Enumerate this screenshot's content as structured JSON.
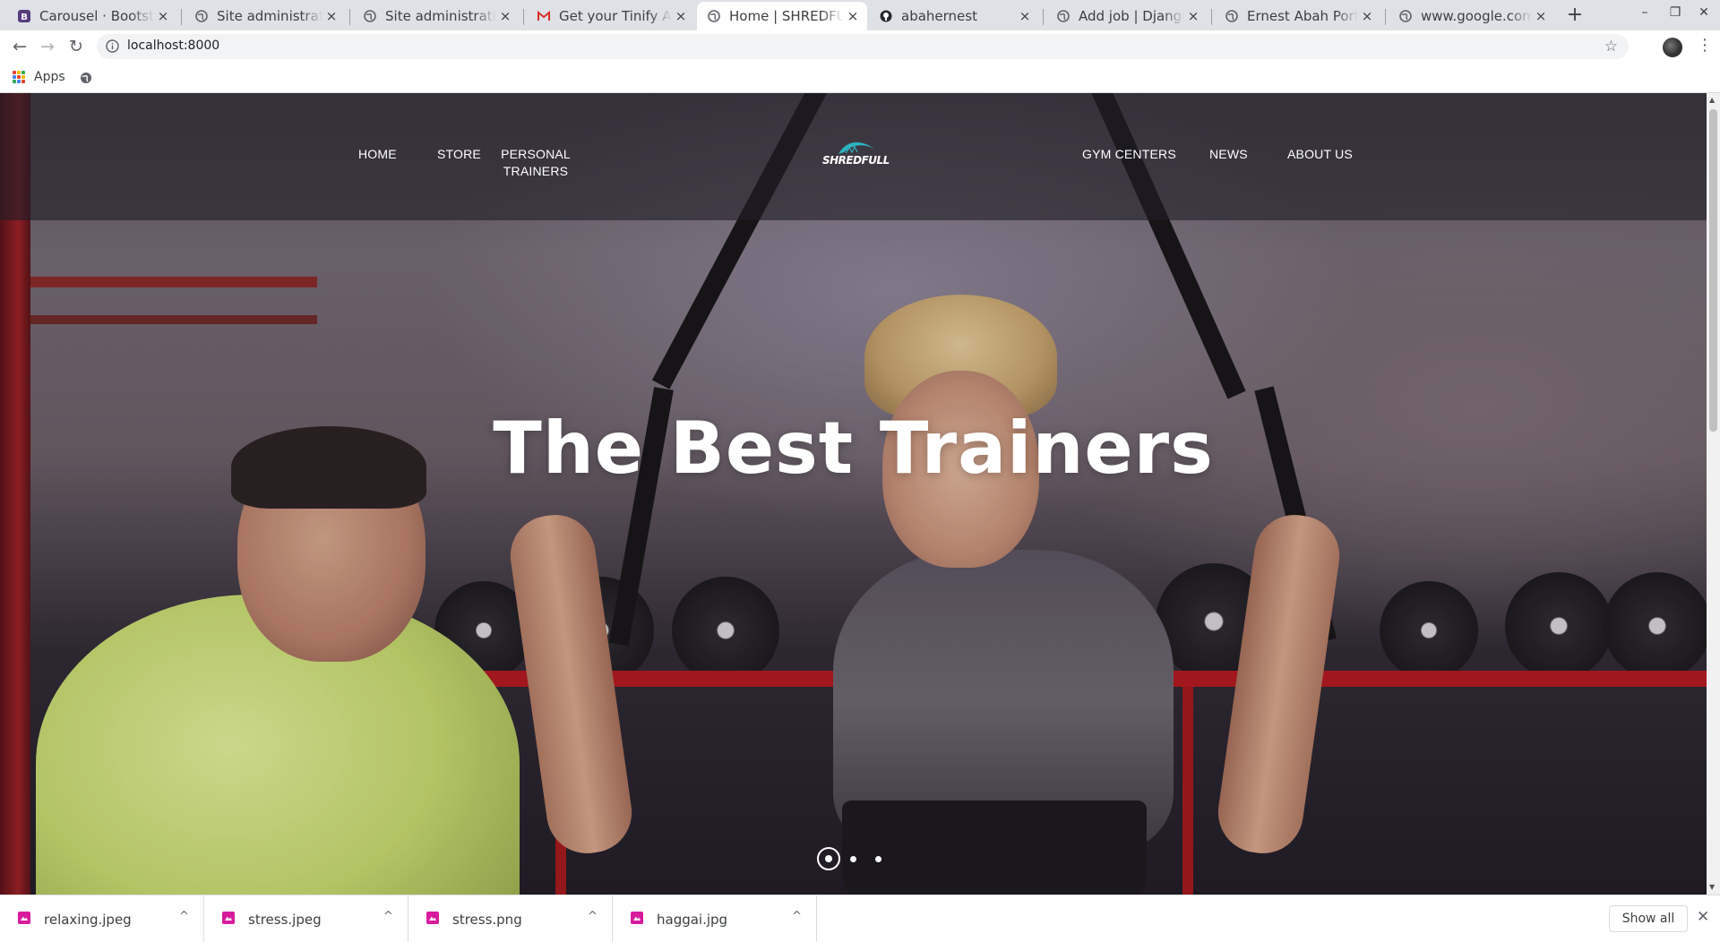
{
  "tabs": [
    {
      "title": "Carousel · Bootstrap",
      "icon": "bootstrap-icon"
    },
    {
      "title": "Site administration",
      "icon": "globe-icon"
    },
    {
      "title": "Site administration",
      "icon": "globe-icon"
    },
    {
      "title": "Get your Tinify API",
      "icon": "gmail-icon"
    },
    {
      "title": "Home | SHREDFULL",
      "icon": "globe-icon",
      "active": true
    },
    {
      "title": "abahernest",
      "icon": "github-icon"
    },
    {
      "title": "Add job | Django site",
      "icon": "globe-icon"
    },
    {
      "title": "Ernest Abah Portfolio",
      "icon": "globe-icon"
    },
    {
      "title": "www.google.com",
      "icon": "globe-icon"
    }
  ],
  "tab_close_glyph": "×",
  "new_tab_glyph": "+",
  "window_controls": {
    "minimize": "–",
    "restore": "❐",
    "close": "✕"
  },
  "toolbar": {
    "url": "localhost:8000",
    "back_glyph": "←",
    "forward_glyph": "→",
    "reload_glyph": "↻",
    "star_glyph": "☆",
    "menu_glyph": "⋮"
  },
  "bookmarks": {
    "apps_label": "Apps"
  },
  "site": {
    "nav": {
      "home": "HOME",
      "store": "STORE",
      "personal_trainers_line1": "PERSONAL",
      "personal_trainers_line2": "TRAINERS",
      "gym_centers": "GYM CENTERS",
      "news": "NEWS",
      "about_us": "ABOUT US"
    },
    "logo_text": "SHREDFULL",
    "logo_color": "#2bb3c0",
    "hero_title": "The Best Trainers",
    "carousel": {
      "slide_count": 3,
      "active_index": 0
    }
  },
  "downloads": {
    "items": [
      {
        "name": "relaxing.jpeg"
      },
      {
        "name": "stress.jpeg"
      },
      {
        "name": "stress.png"
      },
      {
        "name": "haggai.jpg"
      }
    ],
    "show_all_label": "Show all",
    "caret_glyph": "^",
    "close_glyph": "✕"
  },
  "colors": {
    "chrome_bg": "#dee1e6",
    "nav_overlay": "#201e26",
    "download_icon": "#d81b9e"
  }
}
